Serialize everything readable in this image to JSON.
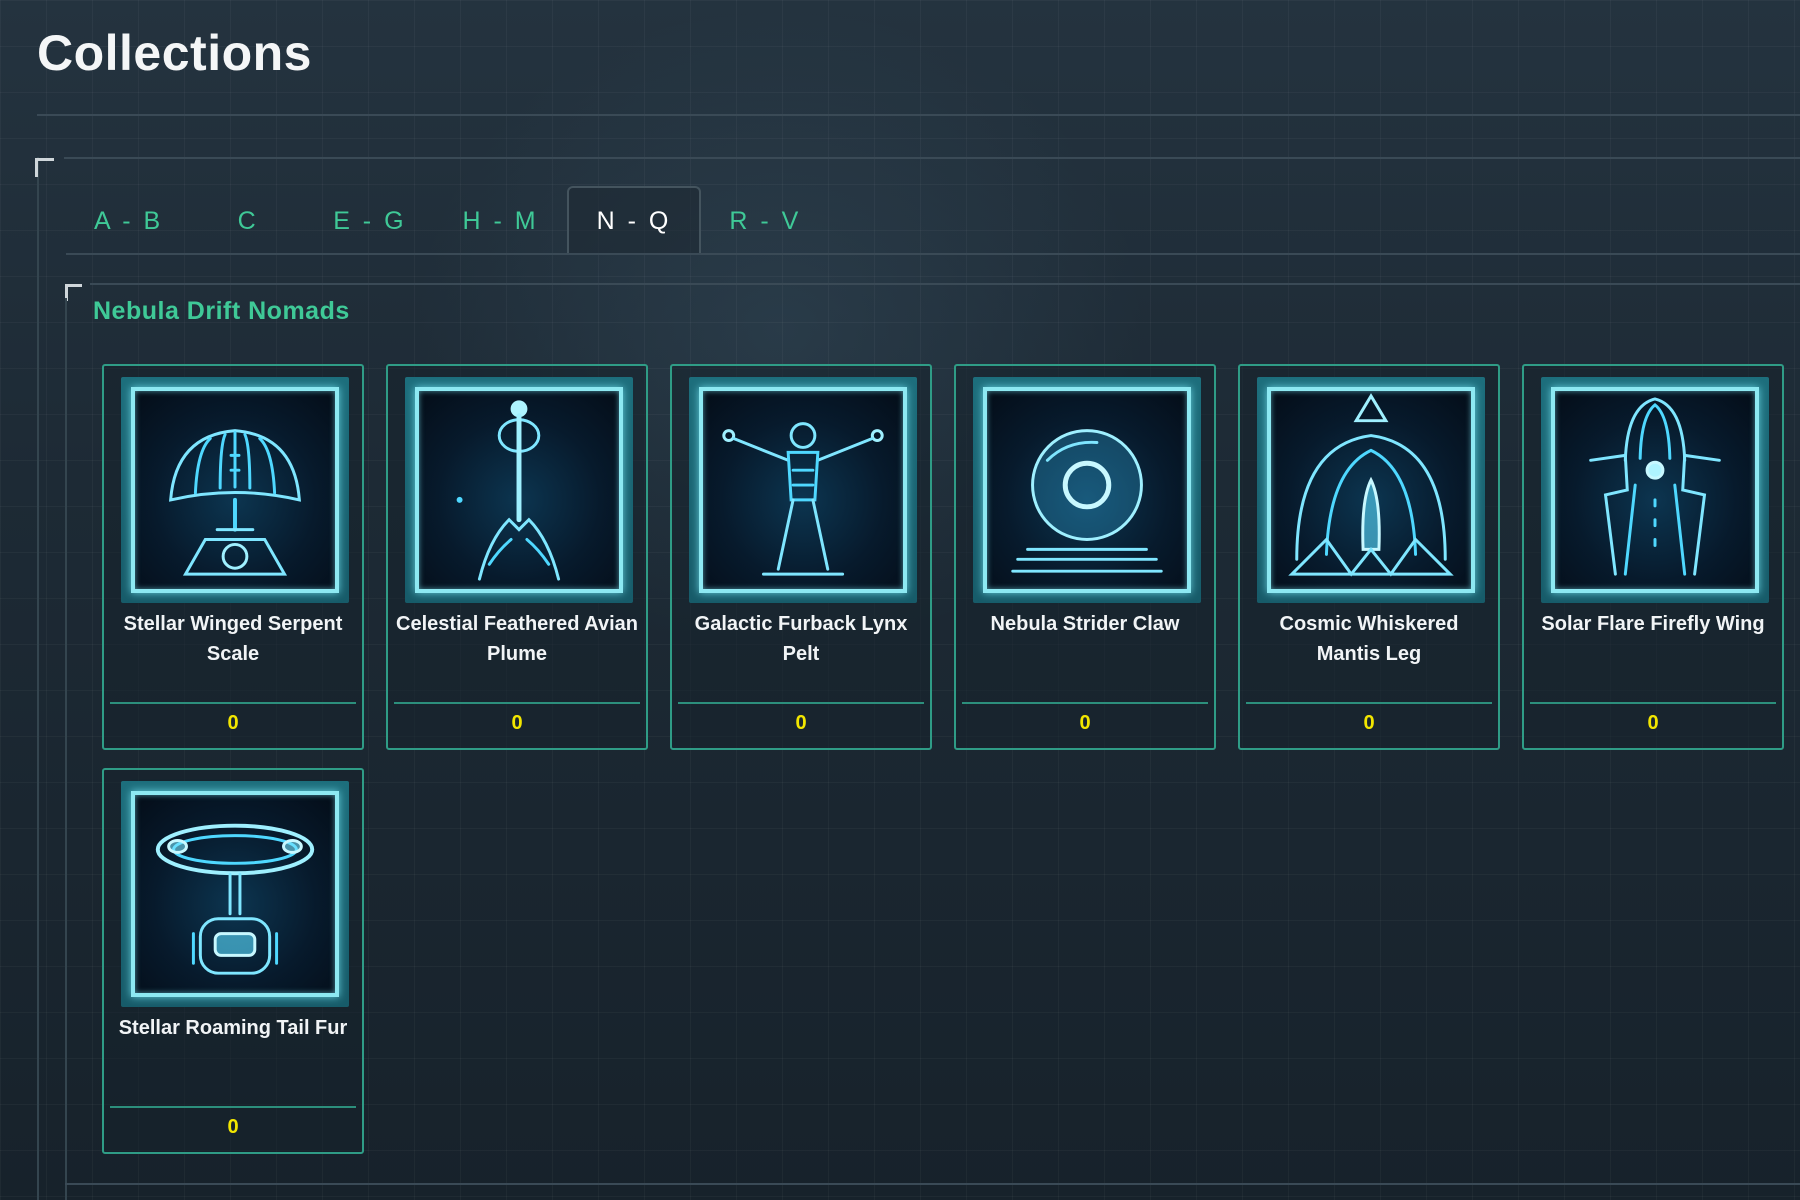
{
  "page": {
    "title": "Collections"
  },
  "tabs": [
    {
      "label": "A - B"
    },
    {
      "label": "C"
    },
    {
      "label": "E - G"
    },
    {
      "label": "H - M"
    },
    {
      "label": "N - Q"
    },
    {
      "label": "R - V"
    }
  ],
  "active_tab": "N - Q",
  "group": {
    "title": "Nebula Drift Nomads",
    "items": [
      {
        "name": "Stellar Winged Serpent Scale",
        "count": "0",
        "icon": "shell-lamp-icon"
      },
      {
        "name": "Celestial Feathered Avian Plume",
        "count": "0",
        "icon": "staff-totem-icon"
      },
      {
        "name": "Galactic Furback Lynx Pelt",
        "count": "0",
        "icon": "figure-arms-icon"
      },
      {
        "name": "Nebula Strider Claw",
        "count": "0",
        "icon": "orb-icon"
      },
      {
        "name": "Cosmic Whiskered Mantis Leg",
        "count": "0",
        "icon": "dome-crystal-icon"
      },
      {
        "name": "Solar Flare Firefly Wing",
        "count": "0",
        "icon": "tower-icon"
      },
      {
        "name": "Stellar Roaming Tail Fur",
        "count": "0",
        "icon": "ring-machine-icon"
      }
    ]
  },
  "colors": {
    "accent_green": "#3fc997",
    "count_yellow": "#f2e600",
    "card_border": "#2f9c86",
    "art_glow": "#8de9f2"
  }
}
